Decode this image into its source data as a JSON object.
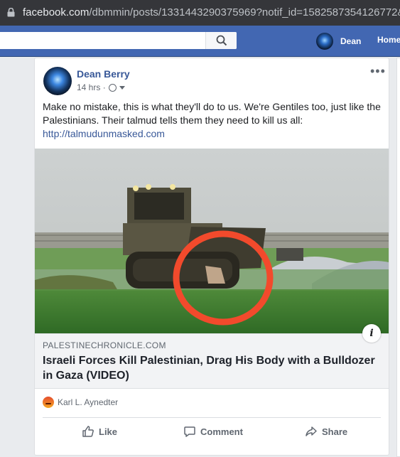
{
  "browser": {
    "url_host": "facebook.com",
    "url_path": "/dbmmin/posts/1331443290375969?notif_id=1582587354126772&notif"
  },
  "topbar": {
    "user_name": "Dean",
    "home_label": "Home"
  },
  "post": {
    "author": "Dean Berry",
    "time": "14 hrs",
    "text": "Make no mistake, this is what they'll do to us. We're Gentiles too, just like the Palestinians. Their talmud tells them they need to kill us all:",
    "link": "http://talmudunmasked.com",
    "link_preview": {
      "domain": "PALESTINECHRONICLE.COM",
      "title": "Israeli Forces Kill Palestinian, Drag His Body with a Bulldozer in Gaza (VIDEO)"
    },
    "reactions": {
      "name": "Karl L. Aynedter",
      "icon": "angry-reaction-icon"
    },
    "actions": {
      "like": "Like",
      "comment": "Comment",
      "share": "Share"
    }
  },
  "colors": {
    "brand_blue": "#4267b2",
    "link_blue": "#385898",
    "highlight_circle": "#f24a2c"
  }
}
